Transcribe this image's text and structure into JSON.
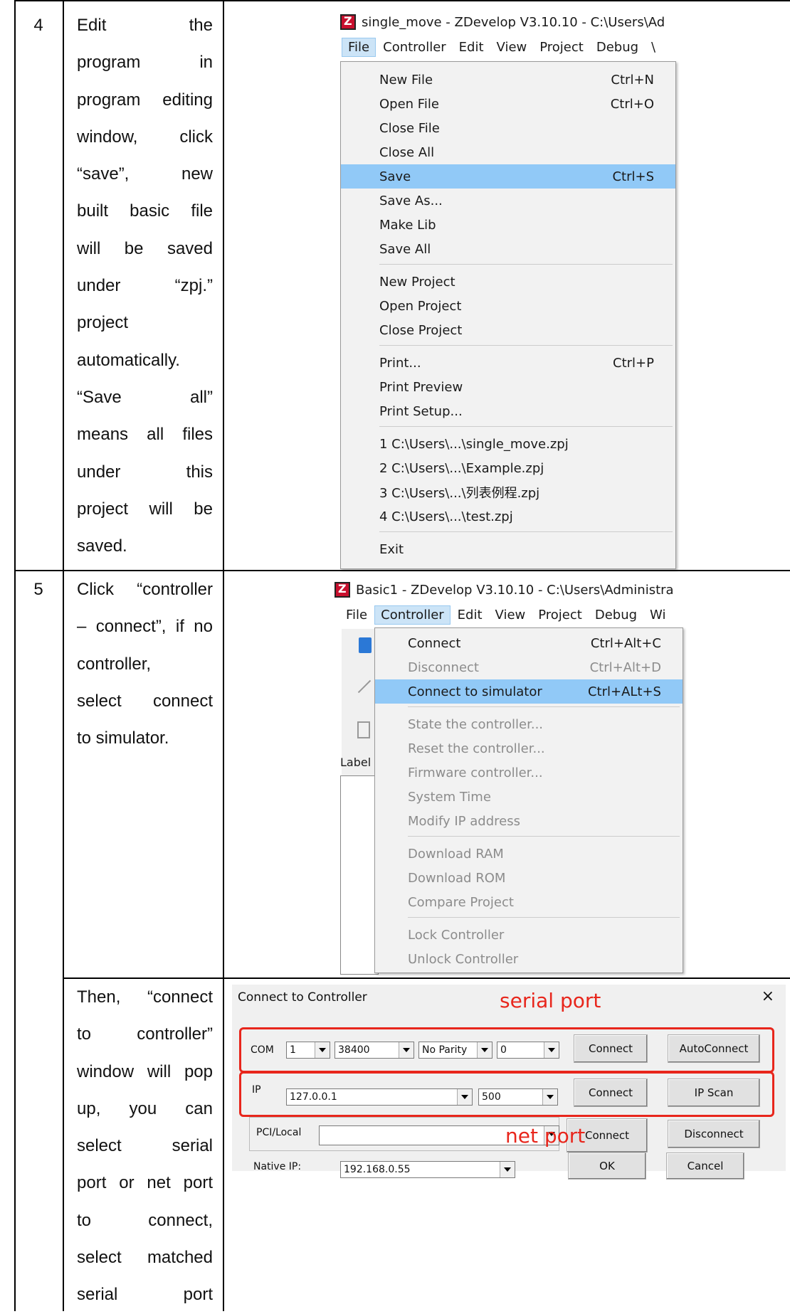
{
  "rows": [
    {
      "number": "4"
    },
    {
      "number": "5"
    }
  ],
  "row4_desc_lines": [
    "Edit the",
    "program in",
    "program editing",
    "window, click",
    "“save”, new",
    "built basic file",
    "will be saved",
    "under “zpj.”",
    "project",
    "automatically.",
    "“Save all”",
    "means all files",
    "under this",
    "project will be",
    "saved."
  ],
  "row5_desc_lines": [
    "Click “controller",
    "– connect”, if no",
    "controller,",
    "select connect",
    "to simulator."
  ],
  "row6_desc_lines": [
    "Then, “connect",
    "to controller”",
    "window will pop",
    "up, you can",
    "select serial",
    "port or net port",
    "to connect,",
    "select matched",
    "serial port"
  ],
  "shot1": {
    "title": "single_move - ZDevelop V3.10.10 - C:\\Users\\Ad",
    "menus": [
      "File",
      "Controller",
      "Edit",
      "View",
      "Project",
      "Debug",
      "\\"
    ],
    "items": [
      {
        "label": "New File",
        "shortcut": "Ctrl+N"
      },
      {
        "label": "Open File",
        "shortcut": "Ctrl+O"
      },
      {
        "label": "Close File",
        "shortcut": ""
      },
      {
        "label": "Close All",
        "shortcut": ""
      },
      {
        "label": "Save",
        "shortcut": "Ctrl+S"
      },
      {
        "label": "Save As...",
        "shortcut": ""
      },
      {
        "label": "Make Lib",
        "shortcut": ""
      },
      {
        "label": "Save All",
        "shortcut": ""
      },
      {
        "label": "New Project",
        "shortcut": ""
      },
      {
        "label": "Open Project",
        "shortcut": ""
      },
      {
        "label": "Close Project",
        "shortcut": ""
      },
      {
        "label": "Print...",
        "shortcut": "Ctrl+P"
      },
      {
        "label": "Print Preview",
        "shortcut": ""
      },
      {
        "label": "Print Setup...",
        "shortcut": ""
      },
      {
        "label": "1 C:\\Users\\...\\single_move.zpj",
        "shortcut": ""
      },
      {
        "label": "2 C:\\Users\\...\\Example.zpj",
        "shortcut": ""
      },
      {
        "label": "3 C:\\Users\\...\\列表例程.zpj",
        "shortcut": ""
      },
      {
        "label": "4 C:\\Users\\...\\test.zpj",
        "shortcut": ""
      },
      {
        "label": "Exit",
        "shortcut": ""
      }
    ]
  },
  "shot2": {
    "title": "Basic1 - ZDevelop V3.10.10 - C:\\Users\\Administra",
    "menus": [
      "File",
      "Controller",
      "Edit",
      "View",
      "Project",
      "Debug",
      "Wi"
    ],
    "side_label": "Label",
    "items": [
      {
        "label": "Connect",
        "shortcut": "Ctrl+Alt+C"
      },
      {
        "label": "Disconnect",
        "shortcut": "Ctrl+Alt+D"
      },
      {
        "label": "Connect to simulator",
        "shortcut": "Ctrl+ALt+S"
      },
      {
        "label": "State the controller...",
        "shortcut": ""
      },
      {
        "label": "Reset the controller...",
        "shortcut": ""
      },
      {
        "label": "Firmware controller...",
        "shortcut": ""
      },
      {
        "label": "System Time",
        "shortcut": ""
      },
      {
        "label": "Modify IP address",
        "shortcut": ""
      },
      {
        "label": "Download RAM",
        "shortcut": ""
      },
      {
        "label": "Download ROM",
        "shortcut": ""
      },
      {
        "label": "Compare Project",
        "shortcut": ""
      },
      {
        "label": "Lock Controller",
        "shortcut": ""
      },
      {
        "label": "Unlock Controller",
        "shortcut": ""
      }
    ]
  },
  "dialog": {
    "title": "Connect to Controller",
    "close": "×",
    "annotation_serial": "serial port",
    "annotation_net": "net port",
    "accent_color": "#e8261c",
    "com_label": "COM",
    "com_port": "1",
    "baud": "38400",
    "parity": "No Parity",
    "stop": "0",
    "connect": "Connect",
    "autoconnect": "AutoConnect",
    "ip_label": "IP",
    "ip_value": "127.0.0.1",
    "ip_timeout": "500",
    "ip_scan": "IP Scan",
    "pci_label": "PCI/Local",
    "pci_value": "",
    "disconnect": "Disconnect",
    "native_ip_label": "Native IP:",
    "native_ip_value": "192.168.0.55",
    "ok": "OK",
    "cancel": "Cancel"
  }
}
